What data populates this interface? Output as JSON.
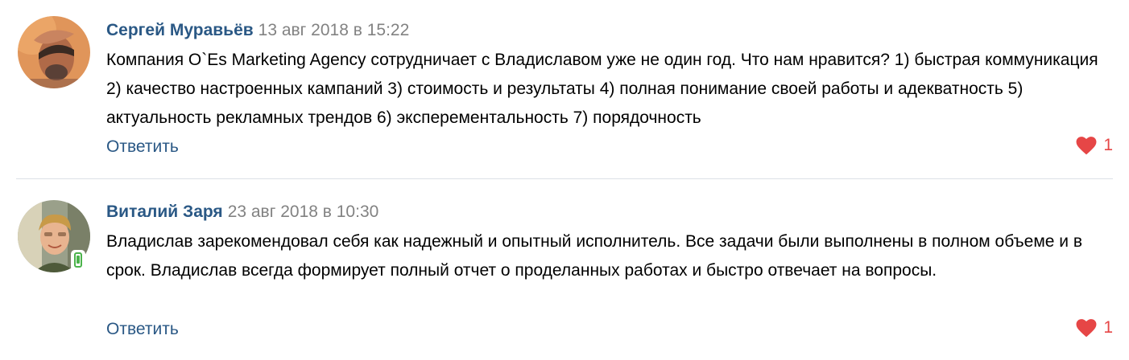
{
  "comments": [
    {
      "author": "Сергей Муравьёв",
      "date": "13 авг 2018 в 15:22",
      "text": "Компания O`Es Marketing Agency сотрудничает с Владиславом уже не один год. Что нам нравится? 1) быстрая коммуникация 2) качество настроенных кампаний 3) стоимость и результаты 4) полная понимание своей работы и адекватность 5) актуальность рекламных трендов 6) эксперементальность 7) порядочность",
      "reply_label": "Ответить",
      "likes": "1"
    },
    {
      "author": "Виталий Заря",
      "date": "23 авг 2018 в 10:30",
      "text": "Владислав зарекомендовал себя как надежный и опытный исполнитель. Все задачи были выполнены в полном объеме и в срок. Владислав всегда формирует полный отчет о проделанных работах и быстро отвечает на вопросы.",
      "reply_label": "Ответить",
      "likes": "1",
      "online_mobile": true
    }
  ],
  "colors": {
    "author_link": "#2a5885",
    "date": "#828282",
    "like_heart": "#e64646",
    "divider": "#dce1e6",
    "online_indicator": "#4bb34b"
  },
  "icons": {
    "like": "heart-icon",
    "online": "mobile-phone-icon"
  }
}
